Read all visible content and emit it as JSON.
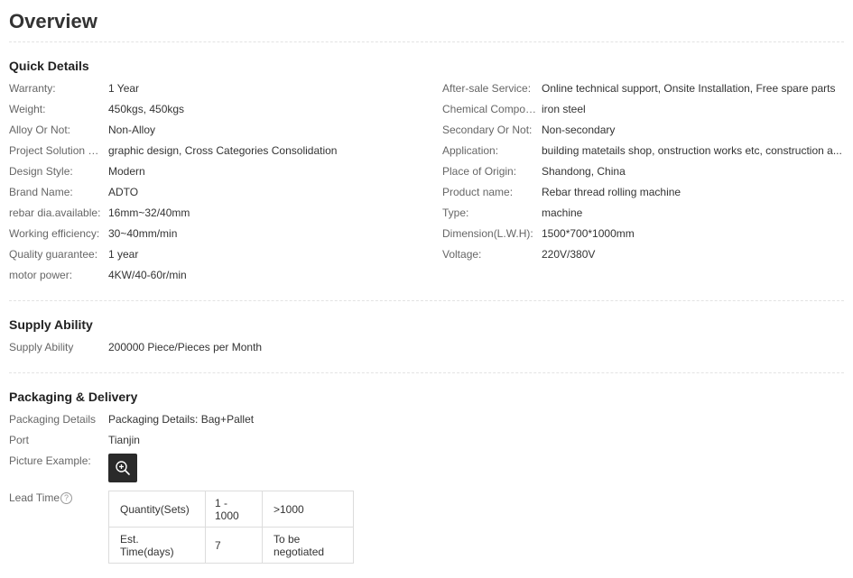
{
  "overview_title": "Overview",
  "quick_details": {
    "heading": "Quick Details",
    "left": [
      {
        "label": "Warranty:",
        "value": "1 Year"
      },
      {
        "label": "Weight:",
        "value": "450kgs, 450kgs"
      },
      {
        "label": "Alloy Or Not:",
        "value": "Non-Alloy"
      },
      {
        "label": "Project Solution Ca...",
        "value": "graphic design, Cross Categories Consolidation"
      },
      {
        "label": "Design Style:",
        "value": "Modern"
      },
      {
        "label": "Brand Name:",
        "value": "ADTO"
      },
      {
        "label": "rebar dia.available:",
        "value": "16mm~32/40mm"
      },
      {
        "label": "Working efficiency:",
        "value": "30~40mm/min"
      },
      {
        "label": "Quality guarantee:",
        "value": "1 year"
      },
      {
        "label": "motor power:",
        "value": "4KW/40-60r/min"
      }
    ],
    "right": [
      {
        "label": "After-sale Service:",
        "value": "Online technical support, Onsite Installation, Free spare parts"
      },
      {
        "label": "Chemical Composi...",
        "value": "iron steel"
      },
      {
        "label": "Secondary Or Not:",
        "value": "Non-secondary"
      },
      {
        "label": "Application:",
        "value": "building matetails shop, onstruction works etc, construction a..."
      },
      {
        "label": "Place of Origin:",
        "value": "Shandong, China"
      },
      {
        "label": "Product name:",
        "value": "Rebar thread rolling machine"
      },
      {
        "label": "Type:",
        "value": "machine"
      },
      {
        "label": "Dimension(L.W.H):",
        "value": "1500*700*1000mm"
      },
      {
        "label": "Voltage:",
        "value": "220V/380V"
      }
    ]
  },
  "supply_ability": {
    "heading": "Supply Ability",
    "label": "Supply Ability",
    "value": "200000 Piece/Pieces per Month"
  },
  "packaging": {
    "heading": "Packaging & Delivery",
    "details_label": "Packaging Details",
    "details_value": "Packaging Details: Bag+Pallet",
    "port_label": "Port",
    "port_value": "Tianjin",
    "picture_label": "Picture Example:",
    "picture_icon": "zoom-in-icon",
    "lead_time_label": "Lead Time",
    "lead_time_help": "?",
    "lead_time_table": [
      [
        "Quantity(Sets)",
        "1 - 1000",
        ">1000"
      ],
      [
        "Est. Time(days)",
        "7",
        "To be negotiated"
      ]
    ]
  }
}
